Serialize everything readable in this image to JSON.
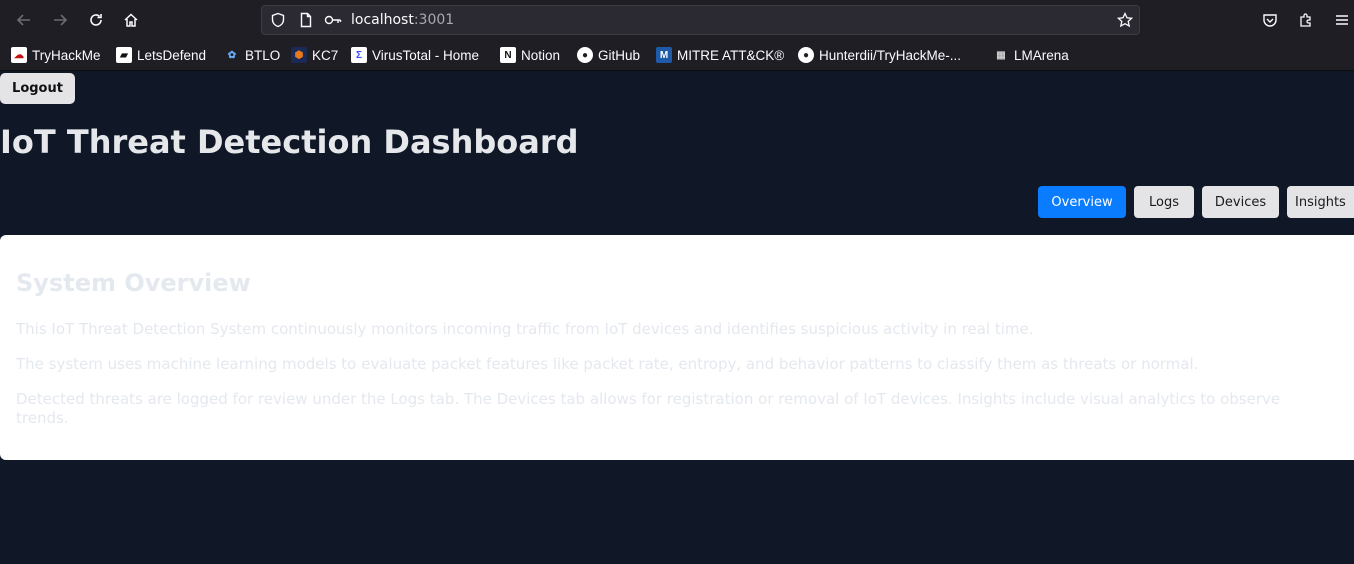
{
  "browser": {
    "url_host": "localhost",
    "url_port": ":3001",
    "bookmarks": [
      {
        "label": "TryHackMe",
        "icon": "tryhackme-icon",
        "color": "#c11111"
      },
      {
        "label": "LetsDefend",
        "icon": "letsdefend-icon",
        "color": "#ffffff"
      },
      {
        "label": "BTLO",
        "icon": "btlo-icon",
        "color": "#6ab0ff"
      },
      {
        "label": "KC7",
        "icon": "kc7-icon",
        "color": "#e97a1c"
      },
      {
        "label": "VirusTotal - Home",
        "icon": "virustotal-icon",
        "color": "#394eff"
      },
      {
        "label": "Notion",
        "icon": "notion-icon",
        "color": "#ffffff"
      },
      {
        "label": "GitHub",
        "icon": "github-icon",
        "color": "#ffffff"
      },
      {
        "label": "MITRE ATT&CK®",
        "icon": "mitre-icon",
        "color": "#1e5aa8"
      },
      {
        "label": "Hunterdii/TryHackMe-...",
        "icon": "github-icon",
        "color": "#ffffff"
      },
      {
        "label": "LMArena",
        "icon": "lmarena-icon",
        "color": "#ffffff"
      }
    ]
  },
  "app": {
    "logout_label": "Logout",
    "title": "IoT Threat Detection Dashboard",
    "tabs": [
      {
        "label": "Overview",
        "active": true
      },
      {
        "label": "Logs",
        "active": false
      },
      {
        "label": "Devices",
        "active": false
      },
      {
        "label": "Insights",
        "active": false
      }
    ],
    "overview": {
      "heading": "System Overview",
      "paragraphs": [
        "This IoT Threat Detection System continuously monitors incoming traffic from IoT devices and identifies suspicious activity in real time.",
        "The system uses machine learning models to evaluate packet features like packet rate, entropy, and behavior patterns to classify them as threats or normal.",
        "Detected threats are logged for review under the Logs tab. The Devices tab allows for registration or removal of IoT devices. Insights include visual analytics to observe trends."
      ]
    }
  },
  "colors": {
    "page_bg": "#101828",
    "accent": "#0a7cff",
    "card_bg": "#ffffff",
    "faded_text": "#e4e8ef"
  }
}
